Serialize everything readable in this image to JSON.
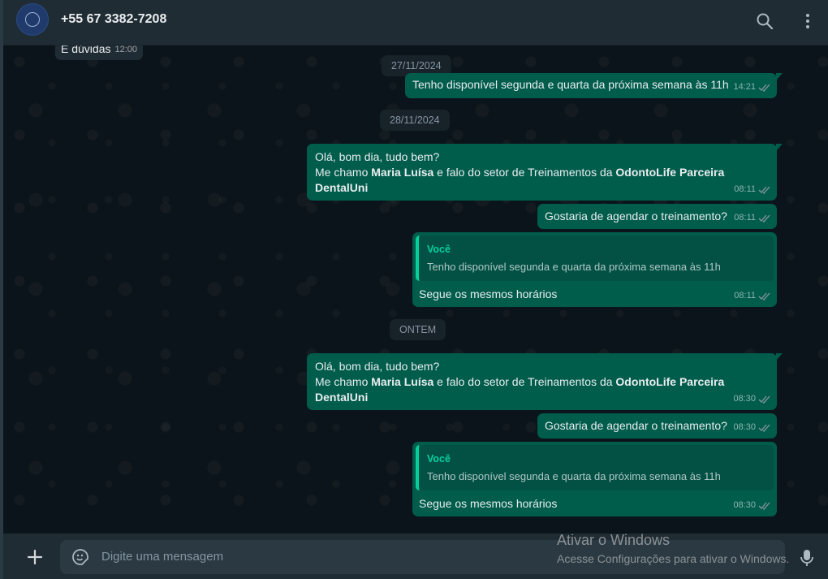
{
  "header": {
    "contact_name": "+55 67 3382-7208",
    "icons": [
      "search-icon",
      "menu-icon"
    ]
  },
  "messages": {
    "m0": {
      "text": "E dúvidas",
      "time": "12:00"
    },
    "d1": "27/11/2024",
    "m1": {
      "text": "Tenho disponível segunda e quarta da próxima semana às 11h",
      "time": "14:21"
    },
    "d2": "28/11/2024",
    "m2": {
      "line1": "Olá, bom dia, tudo bem?",
      "pre": "Me chamo ",
      "name": "Maria Luísa",
      "mid": " e falo do setor de Treinamentos da ",
      "company": "OdontoLife Parceira DentalUni",
      "time": "08:11"
    },
    "m3": {
      "text": "Gostaria de agendar o treinamento?",
      "time": "08:11"
    },
    "m4": {
      "quote_author": "Você",
      "quote_text": "Tenho disponível segunda e quarta da próxima semana às 11h",
      "text": "Segue os mesmos horários",
      "time": "08:11"
    },
    "d3": "ONTEM",
    "m5": {
      "line1": "Olá, bom dia, tudo bem?",
      "pre": "Me chamo ",
      "name": "Maria Luísa",
      "mid": " e falo do setor de Treinamentos da ",
      "company": "OdontoLife Parceira DentalUni",
      "time": "08:30"
    },
    "m6": {
      "text": "Gostaria de agendar o treinamento?",
      "time": "08:30"
    },
    "m7": {
      "quote_author": "Você",
      "quote_text": "Tenho disponível segunda e quarta da próxima semana às 11h",
      "text": "Segue os mesmos horários",
      "time": "08:30"
    }
  },
  "footer": {
    "placeholder": "Digite uma mensagem"
  },
  "watermark": {
    "title": "Ativar o Windows",
    "subtitle": "Acesse Configurações para ativar o Windows."
  },
  "colors": {
    "outgoing_bubble": "#005c4b",
    "background": "#0b141a",
    "header": "#202c33",
    "accent": "#06cf9c"
  }
}
